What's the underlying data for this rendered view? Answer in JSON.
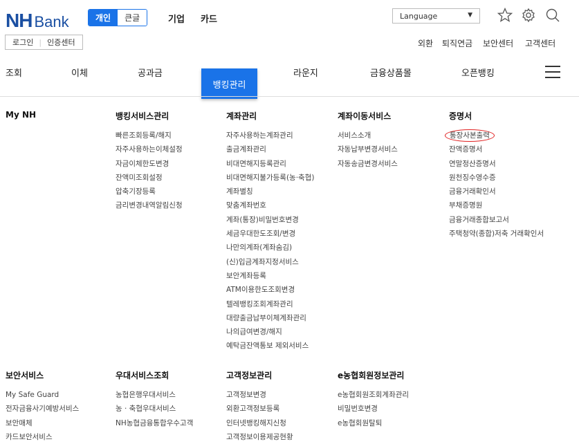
{
  "header": {
    "logo_nh": "NH",
    "logo_bank": "Bank",
    "segment_personal": "개인",
    "segment_large": "큰글",
    "link_corporate": "기업",
    "link_card": "카드",
    "language_label": "Language",
    "login": "로그인",
    "cert_center": "인증센터",
    "util_links": [
      "외환",
      "퇴직연금",
      "보안센터",
      "고객센터"
    ]
  },
  "gnb": {
    "items": [
      "조회",
      "이체",
      "공과금",
      "뱅킹관리",
      "라운지",
      "금융상품몰",
      "오픈뱅킹"
    ]
  },
  "menu": {
    "top": [
      {
        "title": "My NH",
        "items": []
      },
      {
        "title": "뱅킹서비스관리",
        "items": [
          "빠른조회등록/해지",
          "자주사용하는이체설정",
          "자금이체한도변경",
          "잔액미조회설정",
          "압축기장등록",
          "금리변경내역알림신청"
        ]
      },
      {
        "title": "계좌관리",
        "items": [
          "자주사용하는계좌관리",
          "출금계좌관리",
          "비대면해지등록관리",
          "비대면해지불가등록(농·축협)",
          "계좌별칭",
          "맞춤계좌번호",
          "계좌(통장)비밀번호변경",
          "세금우대한도조회/변경",
          "나만의계좌(계좌숨김)",
          "(신)입금계좌지정서비스",
          "보안계좌등록",
          "ATM이용한도조회변경",
          "텔레뱅킹조회계좌관리",
          "대량출금납부이체계좌관리",
          "나의급여변경/해지",
          "예탁금잔액통보 제외서비스"
        ]
      },
      {
        "title": "계좌이동서비스",
        "items": [
          "서비스소개",
          "자동납부변경서비스",
          "자동송금변경서비스"
        ]
      },
      {
        "title": "증명서",
        "items": [
          "통장사본출력",
          "잔액증명서",
          "연말정산증명서",
          "원천징수영수증",
          "금융거래확인서",
          "부채증명원",
          "금융거래종합보고서",
          "주택청약(종합)저축 거래확인서"
        ]
      }
    ],
    "bottom": [
      {
        "title": "보안서비스",
        "items": [
          "My Safe Guard",
          "전자금융사기예방서비스",
          "보안매체",
          "카드보안서비스"
        ]
      },
      {
        "title": "우대서비스조회",
        "items": [
          "농협은행우대서비스",
          "농 · 축협우대서비스",
          "NH농협금융통합우수고객"
        ]
      },
      {
        "title": "고객정보관리",
        "items": [
          "고객정보변경",
          "외환고객정보등록",
          "인터넷뱅킹해지신청",
          "고객정보이용제공현황"
        ]
      },
      {
        "title": "e농협회원정보관리",
        "items": [
          "e농협회원조회계좌관리",
          "비밀번호변경",
          "e농협회원탈퇴"
        ]
      }
    ]
  },
  "colors": {
    "brand": "#1a4fa2",
    "accent": "#1a73e8",
    "highlight": "#e02020"
  }
}
